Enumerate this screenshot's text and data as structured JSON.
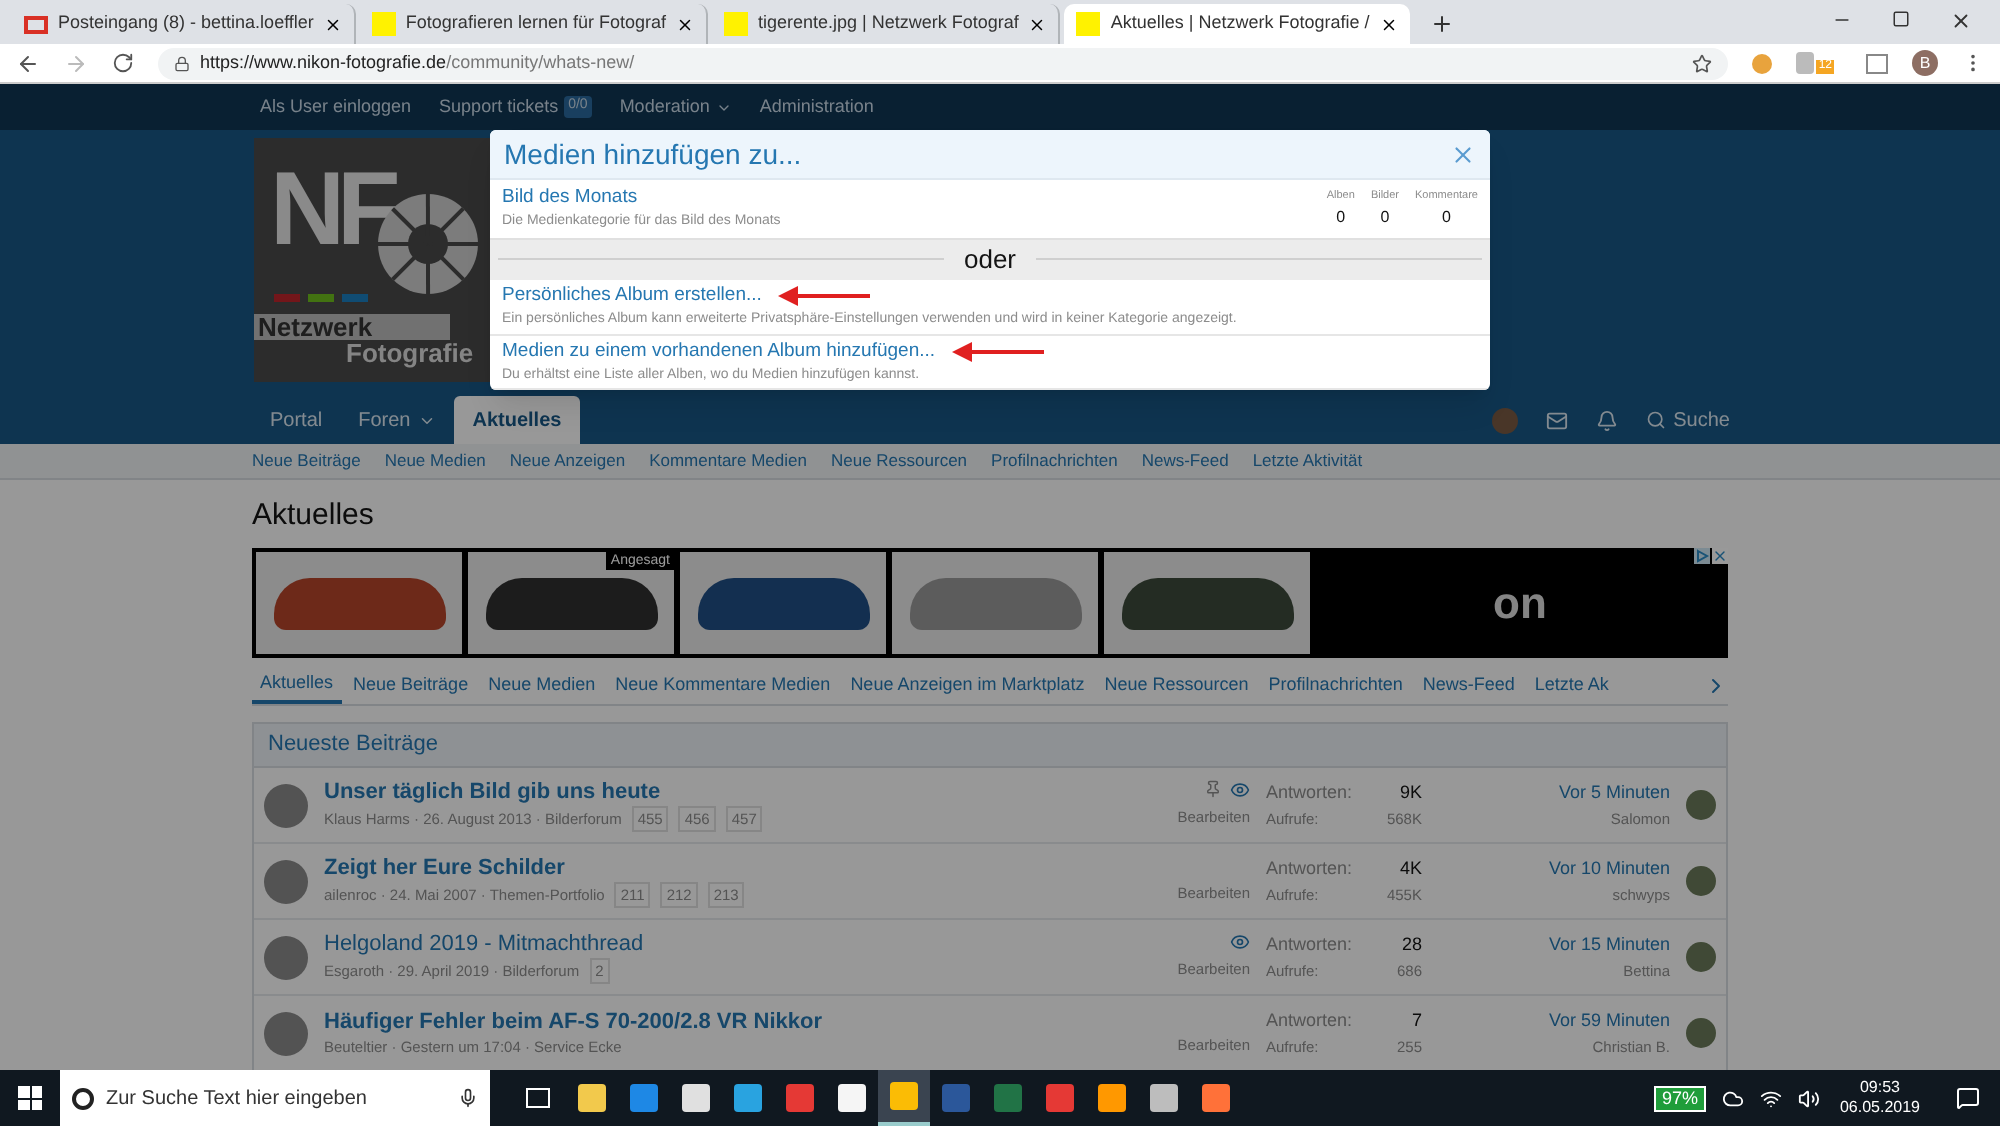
{
  "browser": {
    "tabs": [
      {
        "kind": "mail",
        "title": "Posteingang (8) - bettina.loeffler",
        "selected": false
      },
      {
        "kind": "nf",
        "title": "Fotografieren lernen für Fotograf",
        "selected": false
      },
      {
        "kind": "nf",
        "title": "tigerente.jpg | Netzwerk Fotograf",
        "selected": false
      },
      {
        "kind": "nf",
        "title": "Aktuelles | Netzwerk Fotografie /",
        "selected": true
      }
    ],
    "url_host": "https://www.nikon-fotografie.de",
    "url_path": "/community/whats-new/",
    "extension_badge": "12",
    "profile_initial": "B"
  },
  "topbar": [
    {
      "label": "Als User einloggen"
    },
    {
      "label": "Support tickets",
      "badge": "0/0"
    },
    {
      "label": "Moderation",
      "caret": true
    },
    {
      "label": "Administration"
    }
  ],
  "logo": {
    "letters": "NF",
    "line1": "Netzwerk",
    "line2": "Fotografie"
  },
  "nav": [
    {
      "label": "Portal",
      "selected": false,
      "caret": false
    },
    {
      "label": "Foren",
      "selected": false,
      "caret": true
    },
    {
      "label": "Aktuelles",
      "selected": true,
      "caret": false
    }
  ],
  "nav_search": "Suche",
  "subnav": [
    "Neue Beiträge",
    "Neue Medien",
    "Neue Anzeigen",
    "Kommentare Medien",
    "Neue Ressourcen",
    "Profilnachrichten",
    "News-Feed",
    "Letzte Aktivität"
  ],
  "heading": "Aktuelles",
  "ads": [
    {
      "color": "#6d2919"
    },
    {
      "color": "#1c1c1c",
      "badge": "Angesagt"
    },
    {
      "color": "#132f50"
    },
    {
      "color": "#5c5c5c"
    },
    {
      "color": "#242c23"
    }
  ],
  "ad_brand": "on",
  "tabs": [
    {
      "label": "Aktuelles",
      "selected": true
    },
    {
      "label": "Neue Beiträge",
      "selected": false
    },
    {
      "label": "Neue Medien",
      "selected": false
    },
    {
      "label": "Neue Kommentare Medien",
      "selected": false
    },
    {
      "label": "Neue Anzeigen im Marktplatz",
      "selected": false
    },
    {
      "label": "Neue Ressourcen",
      "selected": false
    },
    {
      "label": "Profilnachrichten",
      "selected": false
    },
    {
      "label": "News-Feed",
      "selected": false
    },
    {
      "label": "Letzte Ak",
      "selected": false
    }
  ],
  "block_title": "Neueste Beiträge",
  "threads": [
    {
      "title": "Unser täglich Bild gib uns heute",
      "unread": true,
      "meta": "Klaus Harms · 26. August 2013 · Bilderforum",
      "pages": [
        "455",
        "456",
        "457"
      ],
      "pinned": true,
      "watched": true,
      "action": "Bearbeiten",
      "replies_label": "Antworten:",
      "replies": "9K",
      "views_label": "Aufrufe:",
      "views": "568K",
      "last_time": "Vor 5 Minuten",
      "last_user": "Salomon"
    },
    {
      "title": "Zeigt her Eure Schilder",
      "unread": true,
      "meta": "ailenroc · 24. Mai 2007 · Themen-Portfolio",
      "pages": [
        "211",
        "212",
        "213"
      ],
      "pinned": false,
      "watched": false,
      "action": "Bearbeiten",
      "replies_label": "Antworten:",
      "replies": "4K",
      "views_label": "Aufrufe:",
      "views": "455K",
      "last_time": "Vor 10 Minuten",
      "last_user": "schwyps"
    },
    {
      "title": "Helgoland 2019 - Mitmachthread",
      "unread": false,
      "meta": "Esgaroth · 29. April 2019 · Bilderforum",
      "pages": [
        "2"
      ],
      "pinned": false,
      "watched": true,
      "action": "Bearbeiten",
      "replies_label": "Antworten:",
      "replies": "28",
      "views_label": "Aufrufe:",
      "views": "686",
      "last_time": "Vor 15 Minuten",
      "last_user": "Bettina"
    },
    {
      "title": "Häufiger Fehler beim AF-S 70-200/2.8 VR Nikkor",
      "unread": true,
      "meta": "Beuteltier · Gestern um 17:04 · Service Ecke",
      "pinned": false,
      "watched": false,
      "action": "Bearbeiten",
      "replies_label": "Antworten:",
      "replies": "7",
      "views_label": "Aufrufe:",
      "views": "255",
      "last_time": "Vor 59 Minuten",
      "last_user": "Christian B."
    }
  ],
  "modal": {
    "title": "Medien hinzufügen zu...",
    "category": {
      "title": "Bild des Monats",
      "description": "Die Medienkategorie für das Bild des Monats",
      "stats": [
        {
          "label": "Alben",
          "value": "0"
        },
        {
          "label": "Bilder",
          "value": "0"
        },
        {
          "label": "Kommentare",
          "value": "0"
        }
      ]
    },
    "separator": "oder",
    "options": [
      {
        "title": "Persönliches Album erstellen...",
        "description": "Ein persönliches Album kann erweiterte Privatsphäre-Einstellungen verwenden und wird in keiner Kategorie angezeigt.",
        "arrow": true
      },
      {
        "title": "Medien zu einem vorhandenen Album hinzufügen...",
        "description": "Du erhältst eine Liste aller Alben, wo du Medien hinzufügen kannst.",
        "arrow": true
      }
    ]
  },
  "taskbar": {
    "search_placeholder": "Zur Suche Text hier eingeben",
    "apps": [
      {
        "color": "#f2c94c",
        "selected": false
      },
      {
        "color": "#1e88e5",
        "selected": false
      },
      {
        "color": "#e0e0e0",
        "selected": false
      },
      {
        "color": "#29a3e0",
        "selected": false
      },
      {
        "color": "#e53935",
        "selected": false
      },
      {
        "color": "#f5f5f5",
        "selected": false
      },
      {
        "color": "#fbbc05",
        "selected": true
      },
      {
        "color": "#2b579a",
        "selected": false
      },
      {
        "color": "#217346",
        "selected": false
      },
      {
        "color": "#e53935",
        "selected": false
      },
      {
        "color": "#ff9800",
        "selected": false
      },
      {
        "color": "#bdbdbd",
        "selected": false
      },
      {
        "color": "#ff7139",
        "selected": false
      }
    ],
    "battery": "97%",
    "time": "09:53",
    "date": "06.05.2019"
  }
}
